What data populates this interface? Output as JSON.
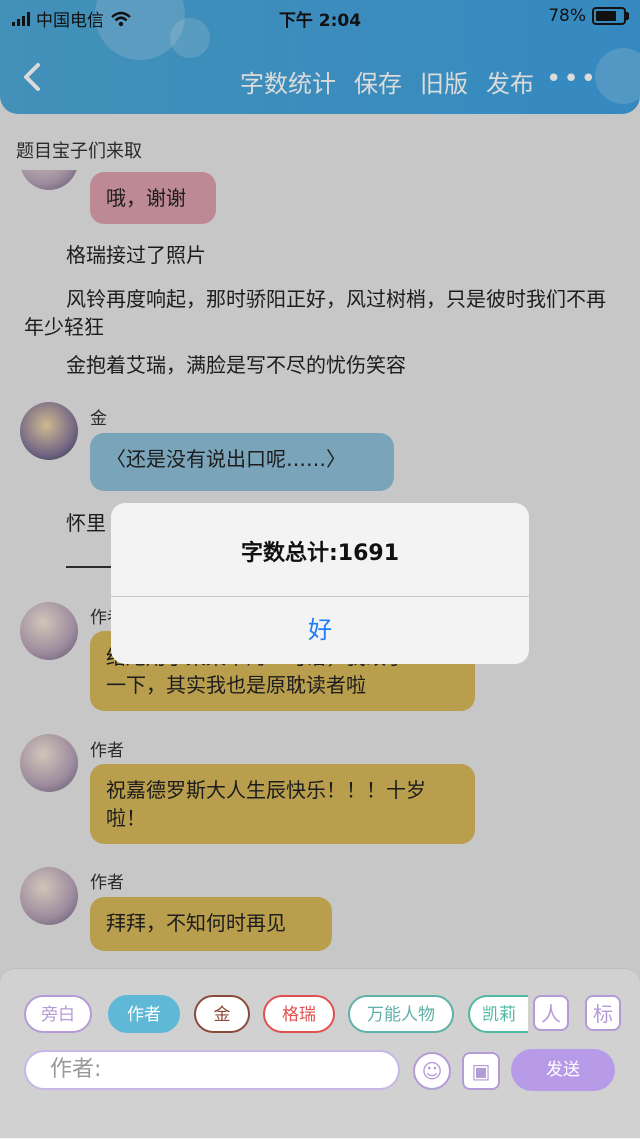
{
  "status": {
    "carrier": "中国电信",
    "time": "下午 2:04",
    "battery": "78%",
    "battery_level": 0.78
  },
  "header": {
    "menu": [
      "字数统计",
      "保存",
      "旧版",
      "发布"
    ],
    "more": "•••"
  },
  "topic": "题目宝子们来取",
  "chat": {
    "msg1": "哦，谢谢",
    "narr1": "格瑞接过了照片",
    "narr2": "风铃再度响起，那时骄阳正好，风过树梢，只是彼时我们不再年少轻狂",
    "narr3": "金抱着艾瑞，满脸是写不尽的忧伤笑容",
    "name_jin": "金",
    "msg_jin": "〈还是没有说出口呢……〉",
    "narr4": "怀里",
    "name_author1": "作者",
    "msg_author1a": "结尾用了某某中的一句话，我改了",
    "msg_author1b": "一下，其实我也是原耽读者啦",
    "name_author2": "作者",
    "msg_author2": "祝嘉德罗斯大人生辰快乐！！！十岁啦！",
    "name_author3": "作者",
    "msg_author3": "拜拜，不知何时再见"
  },
  "alert": {
    "title": "字数总计:1691",
    "ok": "好"
  },
  "roles": [
    "旁白",
    "作者",
    "金",
    "格瑞",
    "万能人物",
    "凯莉"
  ],
  "role_colors": [
    "#b49bd6",
    "#5fb8d6",
    "#8a4a3a",
    "#e05050",
    "#5fb0a8",
    "#4fb8a0"
  ],
  "icons": {
    "user": "人",
    "tag": "标"
  },
  "input_placeholder": "作者:",
  "send": "发送"
}
